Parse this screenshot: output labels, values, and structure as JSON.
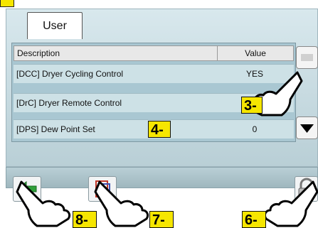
{
  "tab": {
    "label": "User"
  },
  "table": {
    "headers": {
      "description": "Description",
      "value": "Value"
    },
    "rows": [
      {
        "description": "[DCC] Dryer Cycling Control",
        "value": "YES"
      },
      {
        "description": "[DrC] Dryer Remote Control",
        "value": ""
      },
      {
        "description": "[DPS] Dew Point Set",
        "value": "0"
      }
    ]
  },
  "callouts": {
    "c3": "3-",
    "c4": "4-",
    "c6": "6-",
    "c7": "7-",
    "c8": "8-"
  },
  "icons": {
    "scroll_up": "scroll-up-icon",
    "scroll_down": "triangle-down-icon",
    "back": "back-arrow-icon",
    "modify": "page-edit-icon",
    "lock": "lock-icon",
    "pointer": "pointing-hand-icon"
  },
  "colors": {
    "panel": "#c8dce2",
    "table_row": "#cde1e6",
    "callout": "#f6e600"
  }
}
